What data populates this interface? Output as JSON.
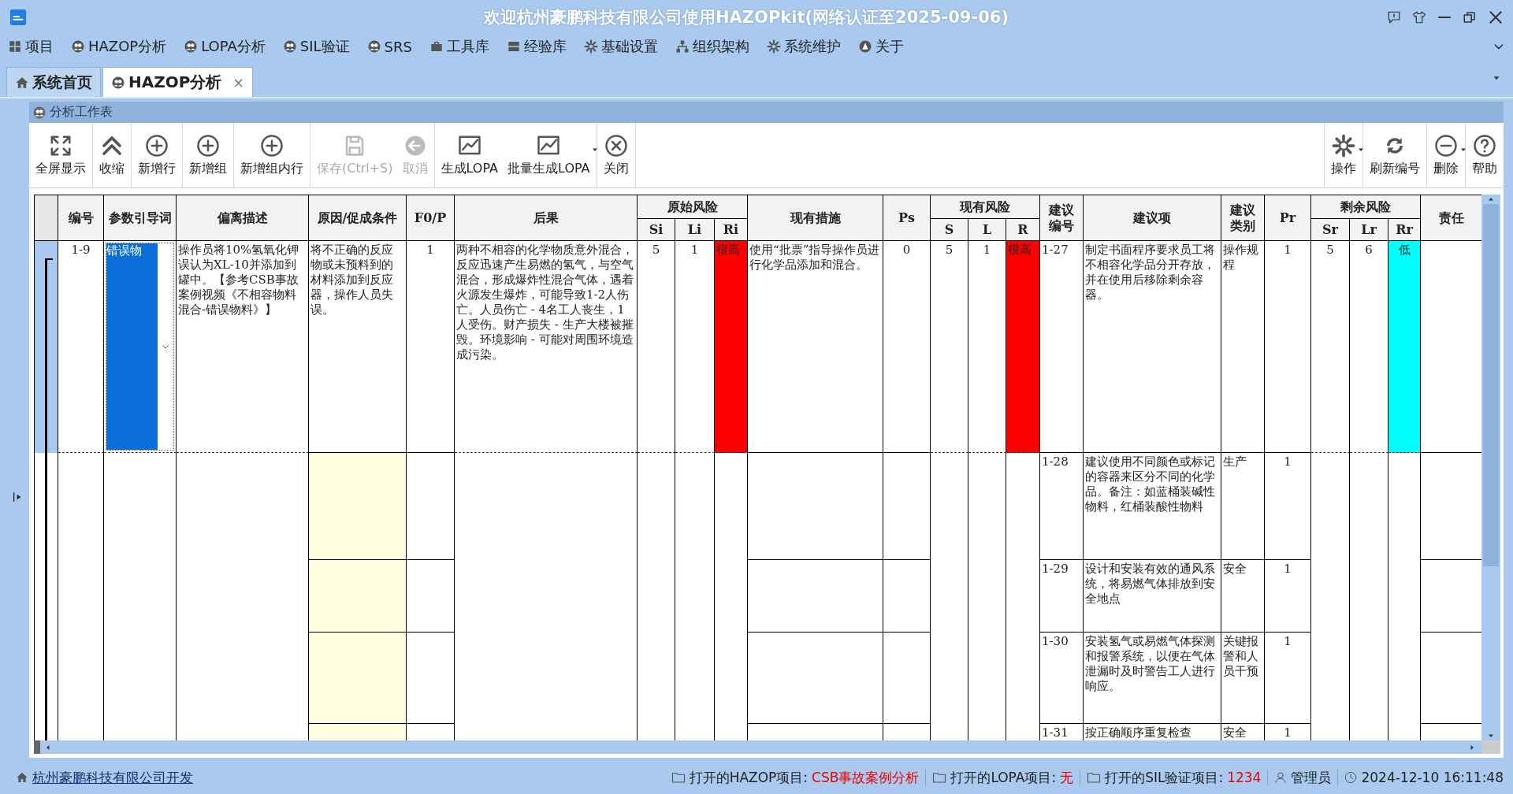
{
  "window": {
    "title": "欢迎杭州豪鹏科技有限公司使用HAZOPkit(网络认证至2025-09-06)"
  },
  "menu": [
    {
      "label": "项目"
    },
    {
      "label": "HAZOP分析"
    },
    {
      "label": "LOPA分析"
    },
    {
      "label": "SIL验证"
    },
    {
      "label": "SRS"
    },
    {
      "label": "工具库"
    },
    {
      "label": "经验库"
    },
    {
      "label": "基础设置"
    },
    {
      "label": "组织架构"
    },
    {
      "label": "系统维护"
    },
    {
      "label": "关于"
    }
  ],
  "tabs": [
    {
      "label": "系统首页",
      "selected": false
    },
    {
      "label": "HAZOP分析",
      "selected": true,
      "close": "×"
    }
  ],
  "panel": {
    "title": "分析工作表"
  },
  "toolbar": {
    "left_groups": [
      [
        {
          "label": "全屏显示",
          "disabled": false,
          "dropdown": false
        }
      ],
      [
        {
          "label": "收缩",
          "disabled": false,
          "dropdown": false
        }
      ],
      [
        {
          "label": "新增行",
          "disabled": false,
          "dropdown": false
        }
      ],
      [
        {
          "label": "新增组",
          "disabled": false,
          "dropdown": false
        }
      ],
      [
        {
          "label": "新增组内行",
          "disabled": false,
          "dropdown": false
        }
      ],
      [
        {
          "label": "保存(Ctrl+S)",
          "disabled": true,
          "dropdown": false
        },
        {
          "label": "取消",
          "disabled": true,
          "dropdown": false
        }
      ],
      [
        {
          "label": "生成LOPA",
          "disabled": false,
          "dropdown": false
        },
        {
          "label": "批量生成LOPA",
          "disabled": false,
          "dropdown": true
        }
      ],
      [
        {
          "label": "关闭",
          "disabled": false,
          "dropdown": false
        }
      ]
    ],
    "right_groups": [
      [
        {
          "label": "操作",
          "disabled": false,
          "dropdown": true
        }
      ],
      [
        {
          "label": "刷新编号",
          "disabled": false,
          "dropdown": false
        }
      ],
      [
        {
          "label": "删除",
          "disabled": false,
          "dropdown": true
        }
      ],
      [
        {
          "label": "帮助",
          "disabled": false,
          "dropdown": false
        }
      ]
    ]
  },
  "table": {
    "columns": [
      {
        "label": "编号"
      },
      {
        "label": "参数引导词"
      },
      {
        "label": "偏离描述"
      },
      {
        "label": "原因/促成条件"
      },
      {
        "label": "F0/P"
      },
      {
        "label": "后果"
      },
      {
        "group": "原始风险",
        "columns": [
          {
            "label": "Si"
          },
          {
            "label": "Li"
          },
          {
            "label": "Ri"
          }
        ]
      },
      {
        "label": "现有措施"
      },
      {
        "label": "Ps"
      },
      {
        "group": "现有风险",
        "columns": [
          {
            "label": "S"
          },
          {
            "label": "L"
          },
          {
            "label": "R"
          }
        ]
      },
      {
        "label": "建议编号"
      },
      {
        "label": "建议项"
      },
      {
        "label": "建议类别"
      },
      {
        "label": "Pr"
      },
      {
        "group": "剩余风险",
        "columns": [
          {
            "label": "Sr"
          },
          {
            "label": "Lr"
          },
          {
            "label": "Rr"
          }
        ]
      },
      {
        "label": "责任"
      }
    ],
    "rows": [
      {
        "selected": true,
        "number": "1-9",
        "guideword": "错误物",
        "deviation": "操作员将10%氢氧化钾误认为XL-10并添加到罐中。【参考CSB事故案例视频《不相容物料混合-错误物料》】",
        "cause": "将不正确的反应物或未预料到的材料添加到反应器，操作人员失误。",
        "fop": "1",
        "consequence": "两种不相容的化学物质意外混合，反应迅速产生易燃的氢气，与空气混合，形成爆炸性混合气体，遇着火源发生爆炸，可能导致1-2人伤亡。人员伤亡 - 4名工人丧生，1人受伤。财产损失 - 生产大楼被摧毁。环境影响 - 可能对周围环境造成污染。",
        "si": "5",
        "li": "1",
        "ri": {
          "text": "很高",
          "color": "#ff0000"
        },
        "safeguard": "使用“批票”指导操作员进行化学品添加和混合。",
        "ps": "0",
        "s": "5",
        "l": "1",
        "r": {
          "text": "很高",
          "color": "#ff0000"
        },
        "rec_no": "1-27",
        "recommendation": "制定书面程序要求员工将不相容化学品分开存放，并在使用后移除剩余容器。",
        "rec_type": "操作规程",
        "pr": "1",
        "sr": "5",
        "lr": "6",
        "rr": {
          "text": "低",
          "color": "#00ffff"
        }
      },
      {
        "selected": false,
        "rec_no": "1-28",
        "recommendation": "建议使用不同颜色或标记的容器来区分不同的化学品。备注：如蓝桶装碱性物料，红桶装酸性物料",
        "rec_type": "生产",
        "pr": "1"
      },
      {
        "selected": false,
        "rec_no": "1-29",
        "recommendation": "设计和安装有效的通风系统，将易燃气体排放到安全地点",
        "rec_type": "安全",
        "pr": "1"
      },
      {
        "selected": false,
        "rec_no": "1-30",
        "recommendation": "安装氢气或易燃气体探测和报警系统，以便在气体泄漏时及时警告工人进行响应。",
        "rec_type": "关键报警和人员干预",
        "pr": "1"
      },
      {
        "selected": false,
        "rec_no": "1-31",
        "recommendation": "按正确顺序重复检查",
        "rec_type": "安全",
        "pr": "1"
      }
    ]
  },
  "status_bar": {
    "developer": "杭州豪鹏科技有限公司开发",
    "projects": [
      {
        "label": "打开的HAZOP项目:",
        "value": "CSB事故案例分析"
      },
      {
        "label": "打开的LOPA项目:",
        "value": "无"
      },
      {
        "label": "打开的SIL验证项目:",
        "value": "1234"
      }
    ],
    "user": "管理员",
    "datetime": "2024-12-10 16:11:48"
  }
}
